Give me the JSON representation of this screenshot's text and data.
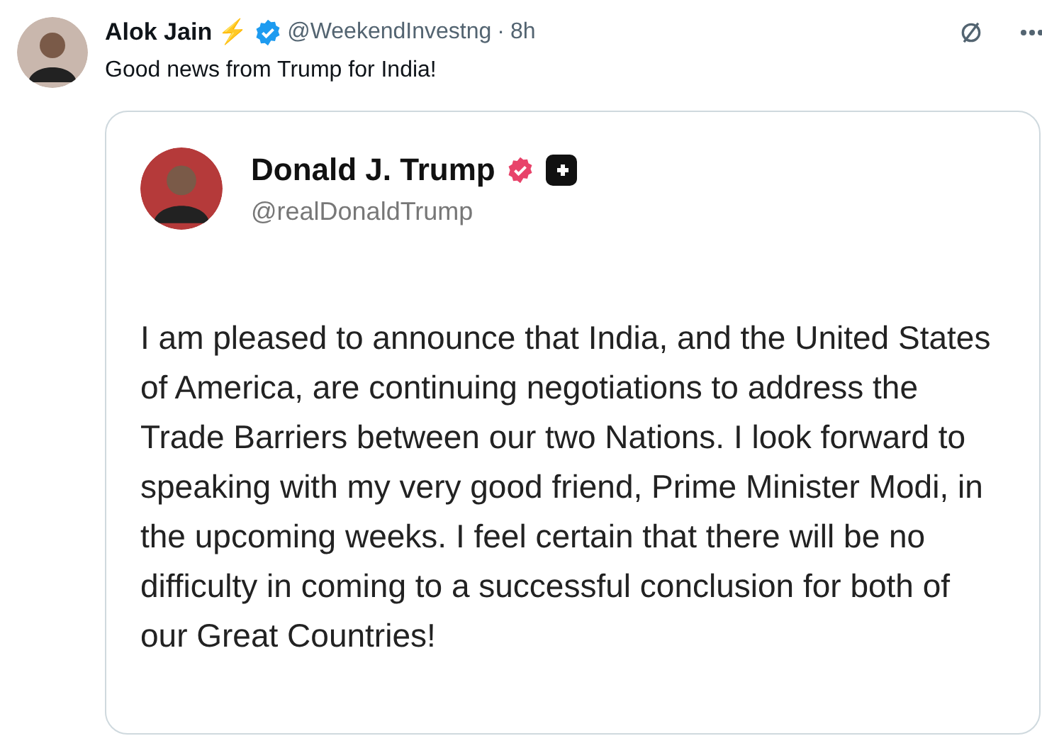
{
  "post": {
    "author": "Alok Jain",
    "emoji": "⚡",
    "verified": true,
    "handle": "@WeekendInvestng",
    "separator": "·",
    "time": "8h",
    "text": "Good news from Trump for India!"
  },
  "quoted": {
    "author": "Donald J. Trump",
    "verified": true,
    "handle": "@realDonaldTrump",
    "text": "I am pleased to announce that India, and the United States of America, are continuing negotiations to address the Trade Barriers between our two Nations. I look forward to speaking with my very good friend, Prime Minister Modi, in the upcoming weeks. I feel certain that there will be no difficulty in coming to a successful conclusion for both of our Great Countries!"
  }
}
